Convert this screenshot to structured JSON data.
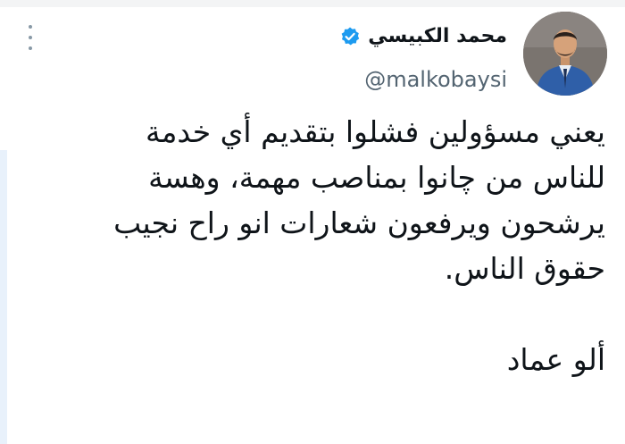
{
  "tweet": {
    "author": {
      "display_name": "محمد الكبيسي",
      "handle": "@malkobaysi",
      "verified": true,
      "avatar_icon": "profile-photo-man-in-suit"
    },
    "text_lines": [
      "يعني مسؤولين فشلوا بتقديم أي خدمة",
      "للناس من چانوا بمناصب مهمة، وهسة",
      "يرشحون ويرفعون شعارات انو راح نجيب",
      "حقوق الناس."
    ],
    "signoff": "ألو عماد",
    "menu_icon": "more-options-icon"
  },
  "colors": {
    "text": "#0f1419",
    "secondary_text": "#536471",
    "verified_blue": "#1d9bf0",
    "rail": "#e8f1fb"
  }
}
